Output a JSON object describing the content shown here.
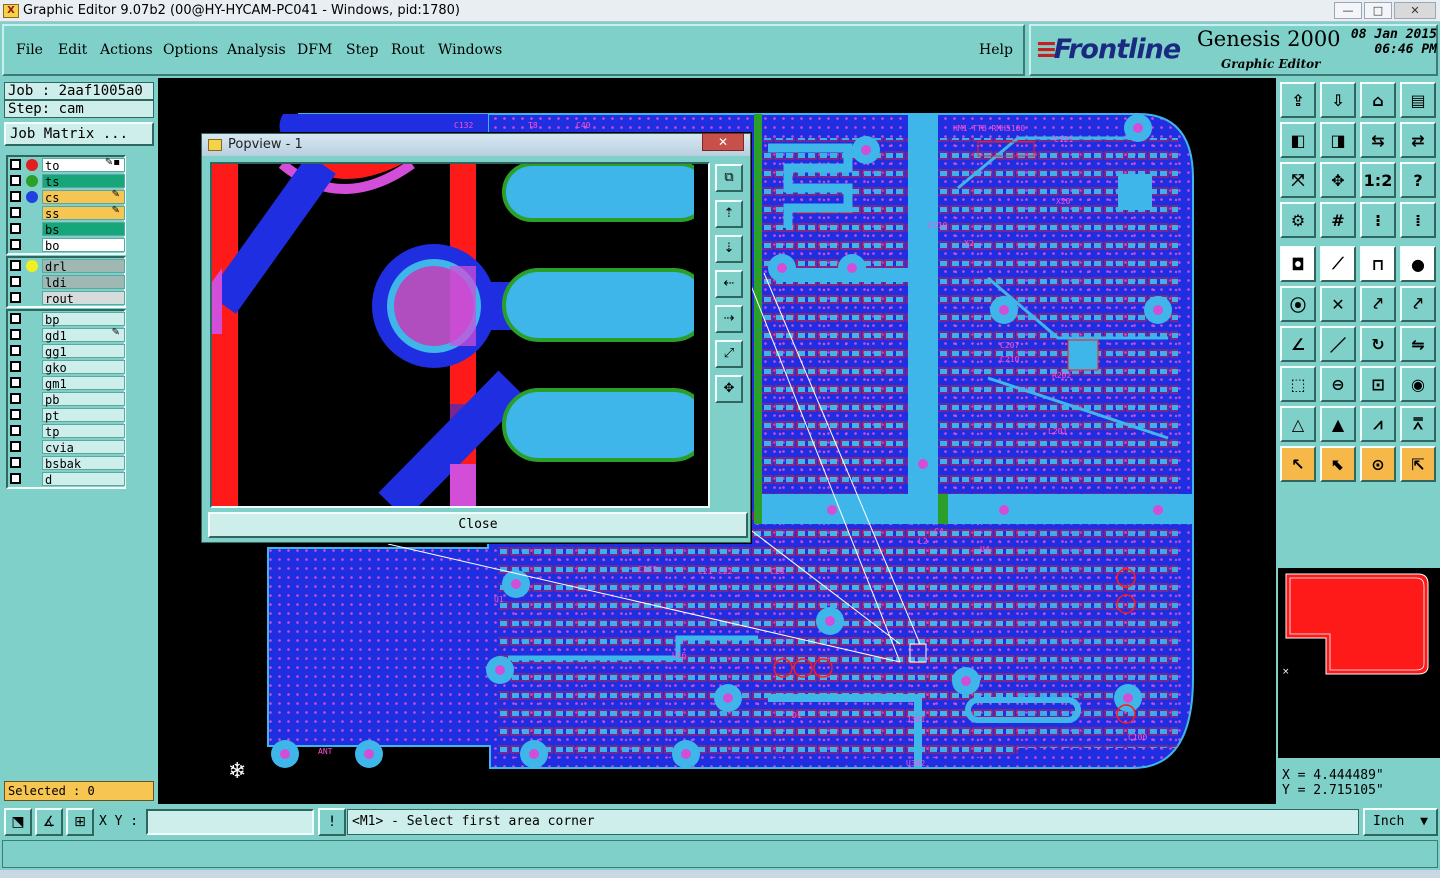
{
  "window": {
    "title": "Graphic Editor 9.07b2 (00@HY-HYCAM-PC041 - Windows, pid:1780)",
    "minimize": "—",
    "maximize": "□",
    "close": "✕"
  },
  "menu": [
    {
      "label": "File"
    },
    {
      "label": "Edit"
    },
    {
      "label": "Actions"
    },
    {
      "label": "Options"
    },
    {
      "label": "Analysis"
    },
    {
      "label": "DFM"
    },
    {
      "label": "Step"
    },
    {
      "label": "Rout"
    },
    {
      "label": "Windows"
    }
  ],
  "help": "Help",
  "brand": {
    "logo": "Frontline",
    "logo_bars": "≡",
    "product": "Genesis 2000",
    "subtitle": "Graphic Editor",
    "date": "08 Jan 2015",
    "time": "06:46 PM"
  },
  "job": {
    "job_line": "Job : 2aaf1005a0",
    "step_line": "Step: cam",
    "job_matrix": "Job Matrix ..."
  },
  "layers_group1": [
    {
      "name": "to",
      "bg": "#ffffff",
      "dot": "#e02020",
      "edit": "✎▪"
    },
    {
      "name": "ts",
      "bg": "#16a67a",
      "dot": "#2aa02a",
      "edit": ""
    },
    {
      "name": "cs",
      "bg": "#f6c552",
      "dot": "#2040e0",
      "edit": "✎"
    },
    {
      "name": "ss",
      "bg": "#f6c552",
      "dot": "",
      "edit": "✎"
    },
    {
      "name": "bs",
      "bg": "#16a67a",
      "dot": "",
      "edit": ""
    },
    {
      "name": "bo",
      "bg": "#ffffff",
      "dot": "",
      "edit": ""
    }
  ],
  "layers_group2": [
    {
      "name": "drl",
      "bg": "#9fb8b4",
      "dot": "#f0f020",
      "edit": ""
    },
    {
      "name": "ldi",
      "bg": "#9fb8b4",
      "dot": "",
      "edit": ""
    },
    {
      "name": "rout",
      "bg": "#d6dcdc",
      "dot": "",
      "edit": ""
    }
  ],
  "layers_group3": [
    {
      "name": "bp",
      "edit": ""
    },
    {
      "name": "gd1",
      "edit": "✎"
    },
    {
      "name": "gg1",
      "edit": ""
    },
    {
      "name": "gko",
      "edit": ""
    },
    {
      "name": "gm1",
      "edit": ""
    },
    {
      "name": "pb",
      "edit": ""
    },
    {
      "name": "pt",
      "edit": ""
    },
    {
      "name": "tp",
      "edit": ""
    },
    {
      "name": "cvia",
      "edit": ""
    },
    {
      "name": "bsbak",
      "edit": ""
    },
    {
      "name": "d",
      "edit": ""
    }
  ],
  "selected_text": "Selected : 0",
  "popview": {
    "title": "Popview - 1",
    "close_label": "Close",
    "close_x": "✕"
  },
  "board_labels": [
    "HM1-TTB-RMH5100",
    "C132",
    "C40",
    "T8",
    "C121",
    "C210",
    "X2",
    "X20",
    "C207",
    "C210",
    "R202",
    "L201",
    "U4",
    "L2",
    "C4",
    "U1",
    "C139",
    "C21",
    "C26",
    "C22",
    "U16",
    "D1",
    "ANT",
    "J301",
    "C100",
    "U302"
  ],
  "bottom": {
    "xy_label": "X Y :",
    "xy_value": "",
    "warn": "!",
    "prompt": "<M1> - Select first area corner",
    "units": "Inch",
    "units_arrow": "▼"
  },
  "coords": {
    "x": "X = 4.444489\"",
    "y": "Y = 2.715105\""
  },
  "colors": {
    "teal": "#7fd0c8",
    "board_blue": "#1f2ee0",
    "pad_cyan": "#3fb6ea",
    "trace_red": "#ff1a1a",
    "magenta": "#d24ed8",
    "green": "#2aa02a"
  }
}
